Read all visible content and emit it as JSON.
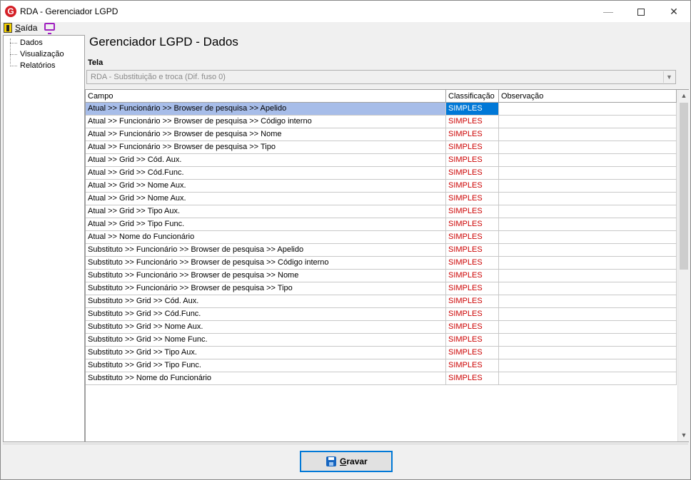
{
  "window": {
    "title": "RDA - Gerenciador LGPD",
    "app_icon_letter": "G",
    "minimize": "—",
    "close": "✕"
  },
  "menu": {
    "saida": "Saída",
    "saida_accel": "S",
    "saida_rest": "aída"
  },
  "tree": {
    "items": [
      {
        "label": "Dados"
      },
      {
        "label": "Visualização"
      },
      {
        "label": "Relatórios"
      }
    ]
  },
  "main": {
    "title": "Gerenciador LGPD - Dados",
    "tela_label": "Tela",
    "tela_value": "RDA - Substituição e troca (Dif. fuso 0)"
  },
  "grid": {
    "columns": {
      "campo": "Campo",
      "classificacao": "Classificação",
      "observacao": "Observação"
    },
    "rows": [
      {
        "campo": "Atual >> Funcionário >> Browser de pesquisa >> Apelido",
        "classificacao": "SIMPLES",
        "observacao": ""
      },
      {
        "campo": "Atual >> Funcionário >> Browser de pesquisa >> Código interno",
        "classificacao": "SIMPLES",
        "observacao": ""
      },
      {
        "campo": "Atual >> Funcionário >> Browser de pesquisa >> Nome",
        "classificacao": "SIMPLES",
        "observacao": ""
      },
      {
        "campo": "Atual >> Funcionário >> Browser de pesquisa >> Tipo",
        "classificacao": "SIMPLES",
        "observacao": ""
      },
      {
        "campo": "Atual >> Grid >> Cód. Aux.",
        "classificacao": "SIMPLES",
        "observacao": ""
      },
      {
        "campo": "Atual >> Grid >> Cód.Func.",
        "classificacao": "SIMPLES",
        "observacao": ""
      },
      {
        "campo": "Atual >> Grid >> Nome Aux.",
        "classificacao": "SIMPLES",
        "observacao": ""
      },
      {
        "campo": "Atual >> Grid >> Nome Aux.",
        "classificacao": "SIMPLES",
        "observacao": ""
      },
      {
        "campo": "Atual >> Grid >> Tipo Aux.",
        "classificacao": "SIMPLES",
        "observacao": ""
      },
      {
        "campo": "Atual >> Grid >> Tipo Func.",
        "classificacao": "SIMPLES",
        "observacao": ""
      },
      {
        "campo": "Atual >> Nome do Funcionário",
        "classificacao": "SIMPLES",
        "observacao": ""
      },
      {
        "campo": "Substituto >> Funcionário >> Browser de pesquisa >> Apelido",
        "classificacao": "SIMPLES",
        "observacao": ""
      },
      {
        "campo": "Substituto >> Funcionário >> Browser de pesquisa >> Código interno",
        "classificacao": "SIMPLES",
        "observacao": ""
      },
      {
        "campo": "Substituto >> Funcionário >> Browser de pesquisa >> Nome",
        "classificacao": "SIMPLES",
        "observacao": ""
      },
      {
        "campo": "Substituto >> Funcionário >> Browser de pesquisa >> Tipo",
        "classificacao": "SIMPLES",
        "observacao": ""
      },
      {
        "campo": "Substituto >> Grid >> Cód. Aux.",
        "classificacao": "SIMPLES",
        "observacao": ""
      },
      {
        "campo": "Substituto >> Grid >> Cód.Func.",
        "classificacao": "SIMPLES",
        "observacao": ""
      },
      {
        "campo": "Substituto >> Grid >> Nome Aux.",
        "classificacao": "SIMPLES",
        "observacao": ""
      },
      {
        "campo": "Substituto >> Grid >> Nome Func.",
        "classificacao": "SIMPLES",
        "observacao": ""
      },
      {
        "campo": "Substituto >> Grid >> Tipo Aux.",
        "classificacao": "SIMPLES",
        "observacao": ""
      },
      {
        "campo": "Substituto >> Grid >> Tipo Func.",
        "classificacao": "SIMPLES",
        "observacao": ""
      },
      {
        "campo": "Substituto >> Nome do Funcionário",
        "classificacao": "SIMPLES",
        "observacao": ""
      }
    ],
    "selected_row": 0
  },
  "footer": {
    "save_accel": "G",
    "save_rest": "ravar"
  },
  "colors": {
    "selection": "#0078d7",
    "selection_light": "#a7bde9",
    "classification_text": "#cc0000"
  }
}
